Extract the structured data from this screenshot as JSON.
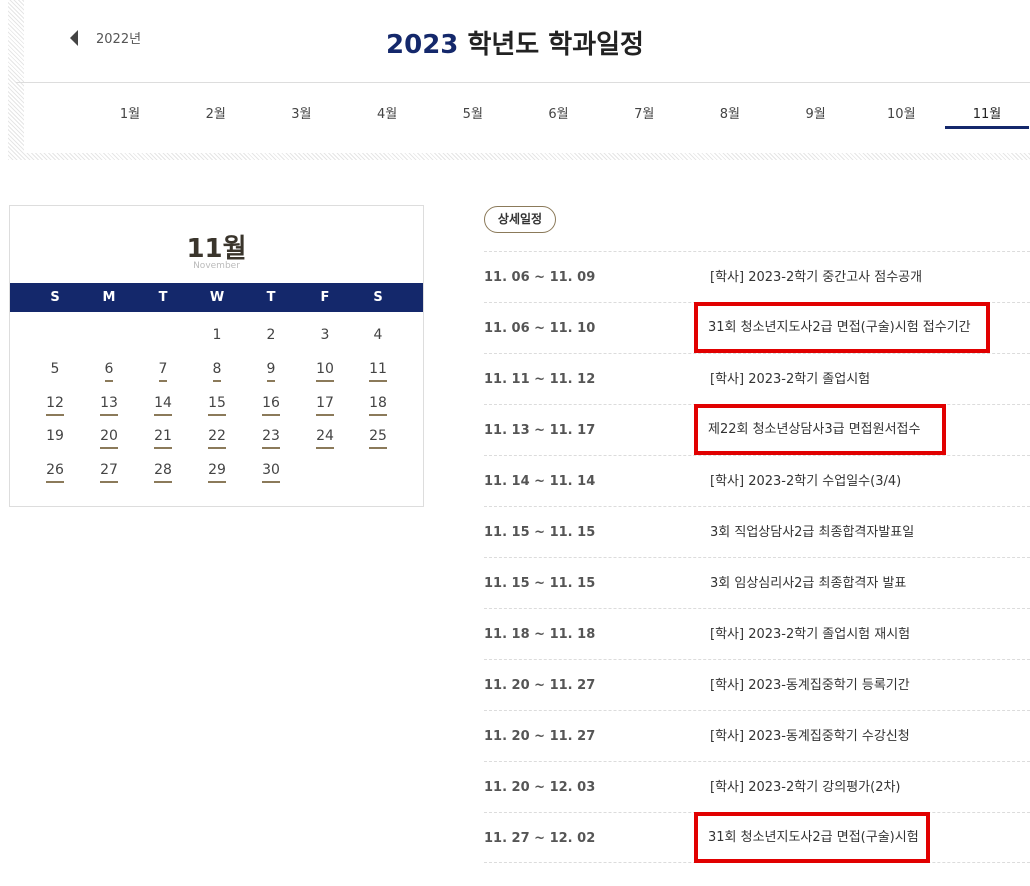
{
  "header": {
    "prev_year": "2022년",
    "title_year": "2023",
    "title_rest": " 학년도 학과일정",
    "accent_color": "#14286b"
  },
  "months": [
    {
      "label": "1월",
      "active": false
    },
    {
      "label": "2월",
      "active": false
    },
    {
      "label": "3월",
      "active": false
    },
    {
      "label": "4월",
      "active": false
    },
    {
      "label": "5월",
      "active": false
    },
    {
      "label": "6월",
      "active": false
    },
    {
      "label": "7월",
      "active": false
    },
    {
      "label": "8월",
      "active": false
    },
    {
      "label": "9월",
      "active": false
    },
    {
      "label": "10월",
      "active": false
    },
    {
      "label": "11월",
      "active": true
    }
  ],
  "calendar": {
    "month_label": "11월",
    "month_en": "November",
    "weekdays": [
      "S",
      "M",
      "T",
      "W",
      "T",
      "F",
      "S"
    ],
    "weeks": [
      [
        null,
        null,
        null,
        1,
        2,
        3,
        4
      ],
      [
        5,
        6,
        7,
        8,
        9,
        10,
        11
      ],
      [
        12,
        13,
        14,
        15,
        16,
        17,
        18
      ],
      [
        19,
        20,
        21,
        22,
        23,
        24,
        25
      ],
      [
        26,
        27,
        28,
        29,
        30,
        null,
        null
      ]
    ],
    "event_days": [
      6,
      7,
      8,
      9,
      10,
      11,
      12,
      13,
      14,
      15,
      16,
      17,
      18,
      20,
      21,
      22,
      23,
      24,
      25,
      26,
      27,
      28,
      29,
      30
    ]
  },
  "detail": {
    "badge": "상세일정",
    "items": [
      {
        "date": "11. 06 ~ 11. 09",
        "title": "[학사] 2023-2학기 중간고사 점수공개",
        "highlight": false
      },
      {
        "date": "11. 06 ~ 11. 10",
        "title": "31회 청소년지도사2급 면접(구술)시험 접수기간",
        "highlight": true
      },
      {
        "date": "11. 11 ~ 11. 12",
        "title": "[학사] 2023-2학기 졸업시험",
        "highlight": false
      },
      {
        "date": "11. 13 ~ 11. 17",
        "title": "제22회 청소년상담사3급 면접원서접수",
        "highlight": true
      },
      {
        "date": "11. 14 ~ 11. 14",
        "title": "[학사] 2023-2학기 수업일수(3/4)",
        "highlight": false
      },
      {
        "date": "11. 15 ~ 11. 15",
        "title": "3회 직업상담사2급 최종합격자발표일",
        "highlight": false
      },
      {
        "date": "11. 15 ~ 11. 15",
        "title": "3회 임상심리사2급 최종합격자 발표",
        "highlight": false
      },
      {
        "date": "11. 18 ~ 11. 18",
        "title": "[학사] 2023-2학기 졸업시험 재시험",
        "highlight": false
      },
      {
        "date": "11. 20 ~ 11. 27",
        "title": "[학사] 2023-동계집중학기 등록기간",
        "highlight": false
      },
      {
        "date": "11. 20 ~ 11. 27",
        "title": "[학사] 2023-동계집중학기 수강신청",
        "highlight": false
      },
      {
        "date": "11. 20 ~ 12. 03",
        "title": "[학사] 2023-2학기 강의평가(2차)",
        "highlight": false
      },
      {
        "date": "11. 27 ~ 12. 02",
        "title": "31회 청소년지도사2급 면접(구술)시험",
        "highlight": true
      }
    ]
  }
}
